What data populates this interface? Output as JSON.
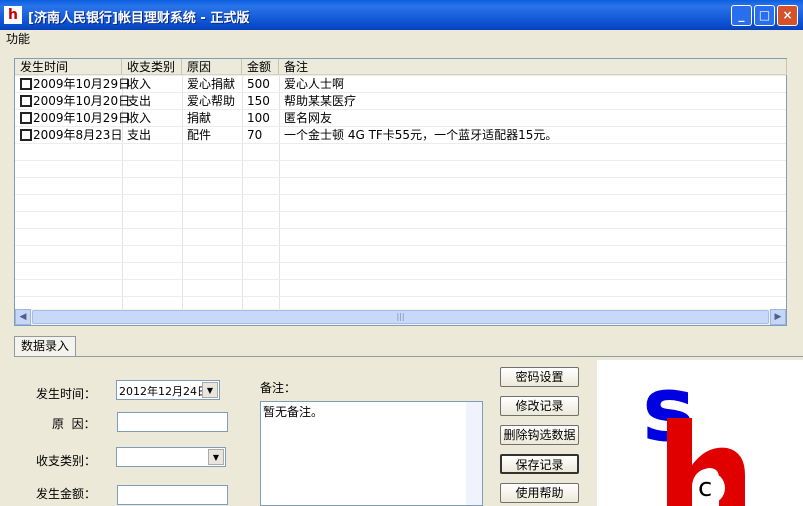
{
  "window": {
    "title": "[济南人民银行]帐目理财系统 - 正式版",
    "minimize": "_",
    "maximize": "□",
    "close": "×"
  },
  "menu": {
    "items": [
      "功能"
    ]
  },
  "table": {
    "columns": [
      "发生时间",
      "收支类别",
      "原因",
      "金额",
      "备注"
    ],
    "rows": [
      [
        "2009年10月29日",
        "收入",
        "爱心捐献",
        "500",
        "爱心人士啊"
      ],
      [
        "2009年10月20日",
        "支出",
        "爱心帮助",
        "150",
        "帮助某某医疗"
      ],
      [
        "2009年10月29日",
        "收入",
        "捐献",
        "100",
        "匿名网友"
      ],
      [
        "2009年8月23日",
        "支出",
        "配件",
        "70",
        "一个金士顿 4G TF卡55元，一个蓝牙适配器15元。"
      ]
    ]
  },
  "tabs": [
    "数据录入"
  ],
  "form": {
    "date_label": "发生时间：",
    "date_value": "2012年12月24日",
    "reason_label": "原  因：",
    "type_label": "收支类别：",
    "amount_label": "发生金额：",
    "note_label": "备注：",
    "note_value": "暂无备注。"
  },
  "buttons": [
    "密码设置",
    "修改记录",
    "删除钩选数据",
    "保存记录",
    "使用帮助"
  ],
  "logo": {
    "letters": "shc"
  }
}
